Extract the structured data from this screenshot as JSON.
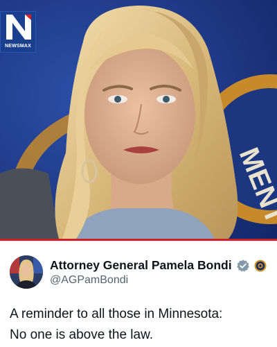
{
  "logo": {
    "letter": "N",
    "brand_text": "NEWSMAX"
  },
  "photo": {
    "background_text": "MENT"
  },
  "post": {
    "display_name": "Attorney General Pamela Bondi",
    "handle": "@AGPamBondi",
    "text_lines": [
      "A reminder to all those in Minnesota:",
      "No one is above the law."
    ]
  },
  "colors": {
    "accent_red": "#d81e28",
    "verified_gray": "#829aab",
    "brand_blue": "#1a3f8f"
  }
}
